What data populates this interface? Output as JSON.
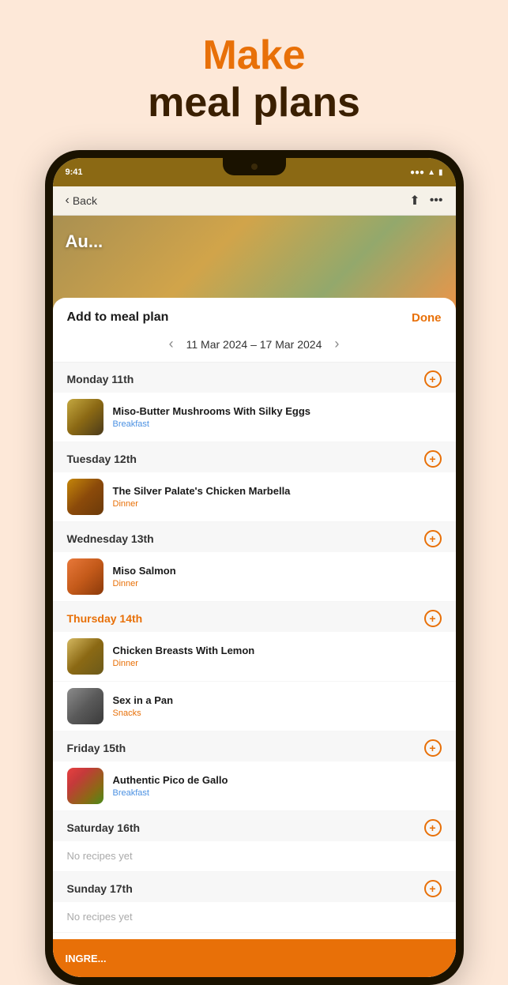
{
  "hero": {
    "line1": "Make",
    "line2": "meal plans"
  },
  "nav": {
    "back_label": "Back",
    "time": "9:41",
    "signal": "●●●",
    "wifi": "WiFi",
    "battery": "🔋"
  },
  "modal": {
    "title": "Add to meal plan",
    "done_label": "Done",
    "week_label": "11 Mar 2024 – 17 Mar 2024",
    "days": [
      {
        "name": "Monday 11th",
        "highlight": false,
        "recipes": [
          {
            "name": "Miso-Butter Mushrooms With Silky Eggs",
            "category": "Breakfast",
            "category_class": "breakfast",
            "thumb": "mushroom"
          }
        ]
      },
      {
        "name": "Tuesday 12th",
        "highlight": false,
        "recipes": [
          {
            "name": "The Silver Palate's Chicken Marbella",
            "category": "Dinner",
            "category_class": "dinner",
            "thumb": "chicken"
          }
        ]
      },
      {
        "name": "Wednesday 13th",
        "highlight": false,
        "recipes": [
          {
            "name": "Miso Salmon",
            "category": "Dinner",
            "category_class": "dinner",
            "thumb": "salmon"
          }
        ]
      },
      {
        "name": "Thursday 14th",
        "highlight": true,
        "recipes": [
          {
            "name": "Chicken Breasts With Lemon",
            "category": "Dinner",
            "category_class": "dinner",
            "thumb": "chicken-lemon"
          },
          {
            "name": "Sex in a Pan",
            "category": "Snacks",
            "category_class": "snacks",
            "thumb": "sex-pan"
          }
        ]
      },
      {
        "name": "Friday 15th",
        "highlight": false,
        "recipes": [
          {
            "name": "Authentic Pico de Gallo",
            "category": "Breakfast",
            "category_class": "breakfast",
            "thumb": "pico"
          }
        ]
      },
      {
        "name": "Saturday 16th",
        "highlight": false,
        "recipes": []
      },
      {
        "name": "Sunday 17th",
        "highlight": false,
        "recipes": []
      }
    ],
    "empty_text": "No recipes yet"
  }
}
